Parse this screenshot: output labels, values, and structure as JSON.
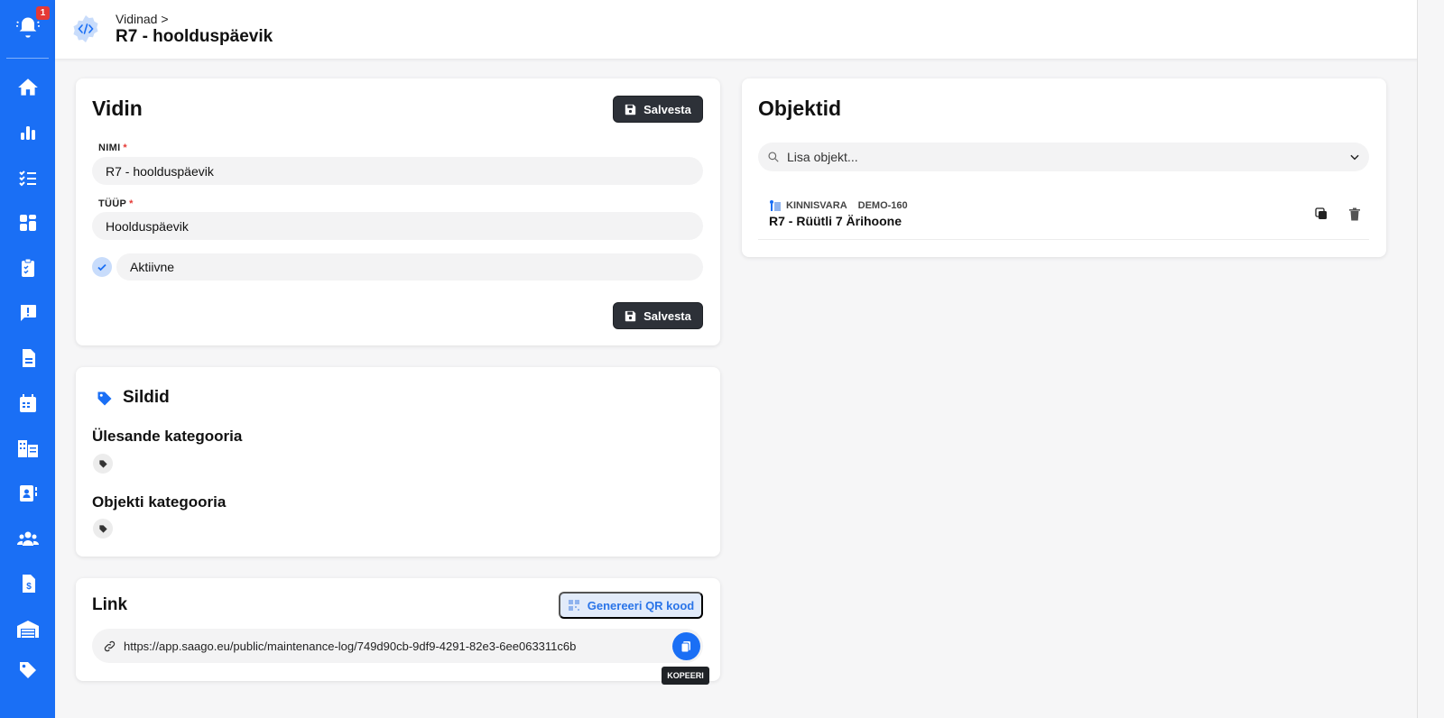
{
  "colors": {
    "brand": "#1a6ff5",
    "dark_button": "#2d3138",
    "required": "#e53935",
    "badge": "#e53935"
  },
  "sidebar": {
    "notification_badge": "1",
    "items": [
      {
        "icon": "home-icon"
      },
      {
        "icon": "bar-chart-icon"
      },
      {
        "icon": "checklist-icon"
      },
      {
        "icon": "widgets-icon"
      },
      {
        "icon": "clipboard-icon"
      },
      {
        "icon": "feedback-icon"
      },
      {
        "icon": "document-icon"
      },
      {
        "icon": "calendar-icon"
      },
      {
        "icon": "buildings-icon"
      },
      {
        "icon": "contact-card-icon"
      },
      {
        "icon": "people-icon"
      },
      {
        "icon": "invoice-icon"
      },
      {
        "icon": "warehouse-icon"
      },
      {
        "icon": "tag-icon"
      }
    ]
  },
  "header": {
    "breadcrumb": "Vidinad >",
    "title": "R7 - hoolduspäevik"
  },
  "widget_card": {
    "title": "Vidin",
    "save_label": "Salvesta",
    "name_label": "NIMI",
    "name_value": "R7 - hoolduspäevik",
    "type_label": "TÜÜP",
    "type_value": "Hoolduspäevik",
    "active_label": "Aktiivne",
    "required_mark": "*"
  },
  "tags_card": {
    "title": "Sildid",
    "task_category": "Ülesande kategooria",
    "object_category": "Objekti kategooria"
  },
  "link_card": {
    "title": "Link",
    "qr_button": "Genereeri QR kood",
    "url": "https://app.saago.eu/public/maintenance-log/749d90cb-9df9-4291-82e3-6ee063311c6b",
    "copy_tooltip": "KOPEERI"
  },
  "objects_card": {
    "title": "Objektid",
    "search_placeholder": "Lisa objekt...",
    "items": [
      {
        "type": "KINNISVARA",
        "code": "DEMO-160",
        "name": "R7 - Rüütli 7 Ärihoone"
      }
    ]
  }
}
